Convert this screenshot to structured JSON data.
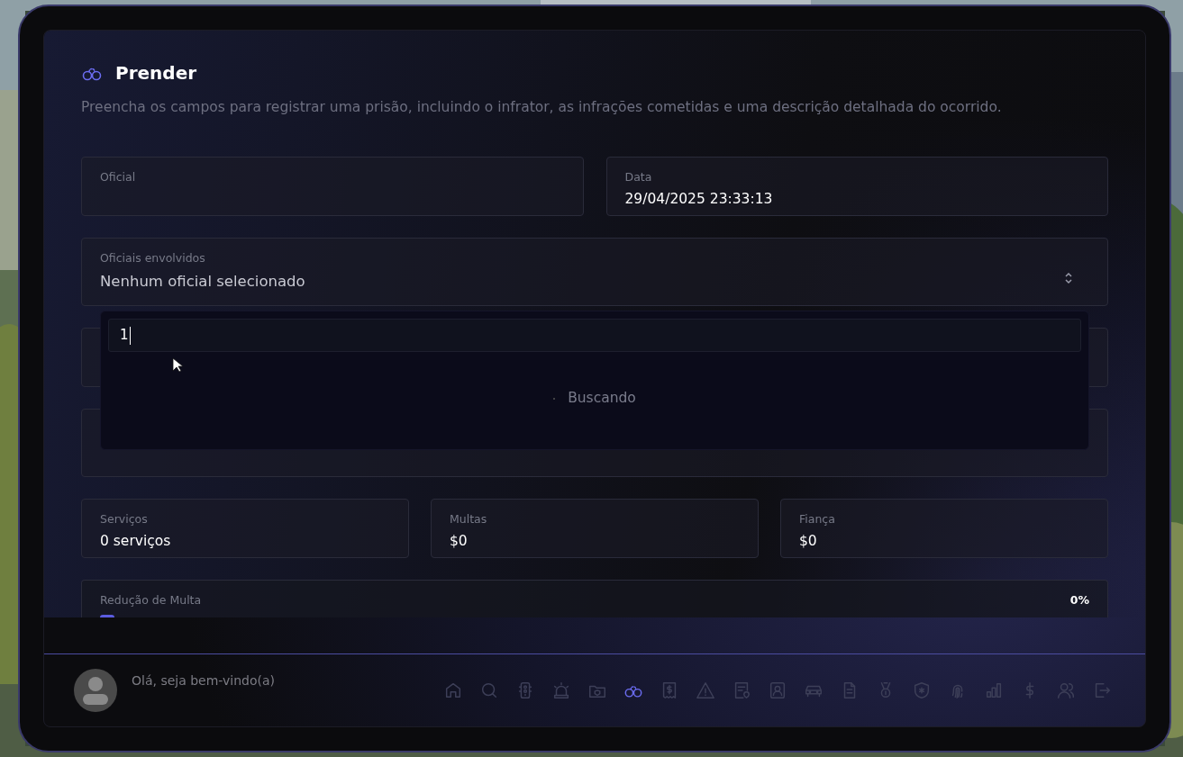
{
  "header": {
    "title": "Prender",
    "description": "Preencha os campos para registrar uma prisão, incluindo o infrator, as infrações cometidas e uma descrição detalhada do ocorrido."
  },
  "fields_row_1": [
    {
      "label": "Oficial"
    },
    {
      "label": "Data",
      "value": "29/04/2025 23:33:13"
    }
  ],
  "officers_select": {
    "label": "Oficiais envolvidos",
    "value": "Nenhum oficial selecionado",
    "expanded": true
  },
  "dropdown": {
    "search_value": "1",
    "status": "Buscando"
  },
  "totals": [
    {
      "label": "Serviços",
      "value": "0 serviços"
    },
    {
      "label": "Multas",
      "value": "$0"
    },
    {
      "label": "Fiança",
      "value": "$0"
    }
  ],
  "fine_reduction": {
    "label": "Redução de Multa",
    "reading": "0%",
    "level": 0
  },
  "footer": {
    "greeting": "Olá, seja bem-vindo(a)"
  },
  "nav": [
    {
      "kind": "home",
      "selected": false
    },
    {
      "kind": "search",
      "selected": false
    },
    {
      "kind": "traffic",
      "selected": false
    },
    {
      "kind": "siren",
      "selected": false
    },
    {
      "kind": "folder",
      "selected": false
    },
    {
      "kind": "handcuffs",
      "selected": true
    },
    {
      "kind": "receipt",
      "selected": false
    },
    {
      "kind": "warning",
      "selected": false
    },
    {
      "kind": "report",
      "selected": false
    },
    {
      "kind": "idcard",
      "selected": false
    },
    {
      "kind": "car",
      "selected": false
    },
    {
      "kind": "file",
      "selected": false
    },
    {
      "kind": "medal",
      "selected": false
    },
    {
      "kind": "shield",
      "selected": false
    },
    {
      "kind": "fingerprint",
      "selected": false
    },
    {
      "kind": "chart",
      "selected": false
    },
    {
      "kind": "dollar",
      "selected": false
    },
    {
      "kind": "users",
      "selected": false
    },
    {
      "kind": "logout",
      "selected": false
    }
  ]
}
